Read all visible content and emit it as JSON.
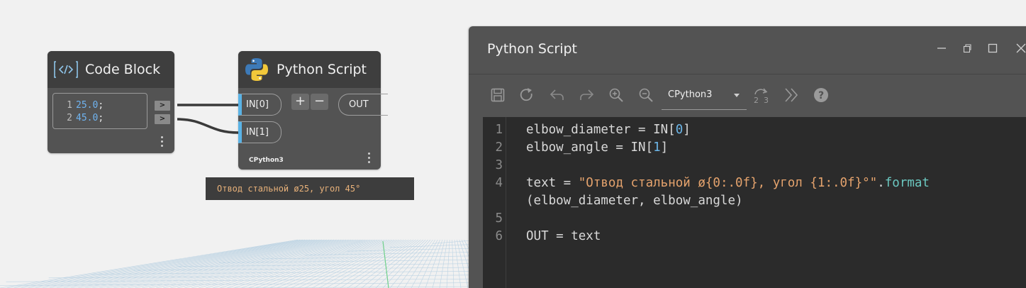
{
  "code_block_node": {
    "title": "Code Block",
    "lines": [
      {
        "ln": "1",
        "value": "25.0",
        "semi": ";"
      },
      {
        "ln": "2",
        "value": "45.0",
        "semi": ";"
      }
    ],
    "output_port_label": ">"
  },
  "python_node": {
    "title": "Python Script",
    "inputs": [
      "IN[0]",
      "IN[1]"
    ],
    "add_label": "+",
    "remove_label": "−",
    "output": "OUT",
    "engine": "CPython3"
  },
  "preview": {
    "text": "Отвод стальной ø25, угол 45°"
  },
  "editor": {
    "title": "Python Script",
    "engine": "CPython3",
    "code_lines": [
      {
        "ln": "1",
        "a": "elbow_diameter = IN[",
        "num": "0",
        "b": "]"
      },
      {
        "ln": "2",
        "a": "elbow_angle = IN[",
        "num": "1",
        "b": "]"
      },
      {
        "ln": "3",
        "text": ""
      },
      {
        "ln": "4",
        "a": "text = ",
        "str": "\"Отвод стальной ø{0:.0f}, угол {1:.0f}°\"",
        "dot": ".",
        "fn": "format"
      },
      {
        "ln": "",
        "text": "(elbow_diameter, elbow_angle)"
      },
      {
        "ln": "5",
        "text": ""
      },
      {
        "ln": "6",
        "text": "OUT = text"
      }
    ]
  },
  "colors": {
    "canvas_bg": "#f1f1f1",
    "node_body": "#535353",
    "node_header": "#3e3e3e",
    "editor_bg": "#2b2b2b",
    "input_accent": "#5ab3e6",
    "preview_text": "#e9b27a"
  },
  "icons": {
    "code_block": "code-brackets-icon",
    "python": "python-logo-icon",
    "save": "save-icon",
    "run": "run-icon",
    "undo": "undo-icon",
    "redo": "redo-icon",
    "zoom_in": "zoom-in-icon",
    "zoom_out": "zoom-out-icon",
    "convert": "convert-2to3-icon",
    "more": "more-icon",
    "help": "help-icon"
  }
}
